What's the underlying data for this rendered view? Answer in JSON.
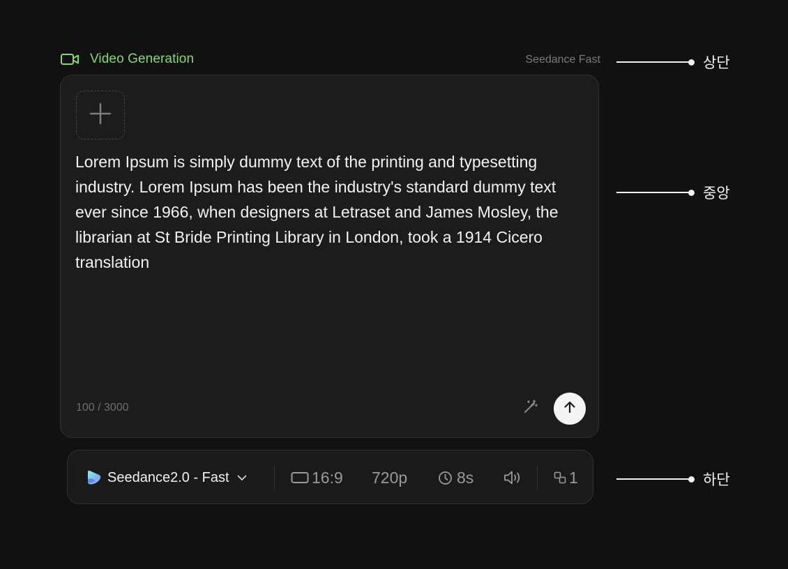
{
  "header": {
    "title": "Video Generation",
    "title_icon": "video-camera-icon",
    "model_label": "Seedance Fast",
    "accent_color": "#86d877"
  },
  "prompt": {
    "text": "Lorem Ipsum is simply dummy text of the printing and typesetting industry. Lorem Ipsum has been the industry's standard dummy text ever since 1966, when designers at Letraset and James Mosley, the librarian at St Bride Printing Library in London, took a 1914 Cicero translation",
    "char_count": "100 / 3000",
    "add_icon": "plus-icon",
    "enhance_icon": "magic-wand-icon",
    "send_icon": "arrow-up-icon"
  },
  "toolbar": {
    "model": "Seedance2.0 - Fast",
    "model_icon": "seedance-logo-icon",
    "dropdown_icon": "chevron-down-icon",
    "aspect_ratio": "16:9",
    "resolution": "720p",
    "duration": "8s",
    "audio_icon": "speaker-icon",
    "count": "1"
  },
  "annotations": {
    "top": "상단",
    "middle": "중앙",
    "bottom": "하단"
  }
}
